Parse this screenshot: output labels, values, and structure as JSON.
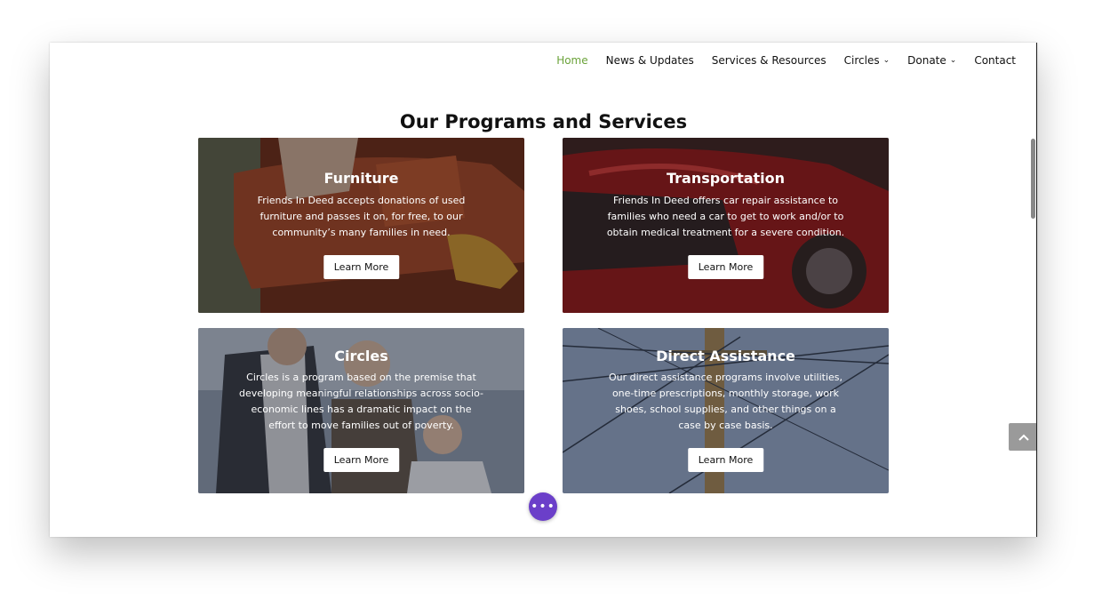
{
  "nav": {
    "items": [
      {
        "label": "Home",
        "active": true
      },
      {
        "label": "News & Updates"
      },
      {
        "label": "Services & Resources"
      },
      {
        "label": "Circles",
        "dropdown": true
      },
      {
        "label": "Donate",
        "dropdown": true
      },
      {
        "label": "Contact"
      }
    ]
  },
  "section": {
    "title": "Our Programs and Services"
  },
  "cards": [
    {
      "title": "Furniture",
      "text": "Friends In Deed accepts donations of used furniture and passes it on, for free, to our community’s many families in need.",
      "button": "Learn More"
    },
    {
      "title": "Transportation",
      "text": "Friends In Deed offers car repair assistance to families who need a car to get to work and/or to obtain medical treatment for a severe condition.",
      "button": "Learn More"
    },
    {
      "title": "Circles",
      "text": "Circles is a program  based on the premise that developing meaningful relationships across socio-economic lines has a dramatic impact on the effort to move families out of poverty.",
      "button": "Learn More"
    },
    {
      "title": "Direct Assistance",
      "text": "Our direct assistance programs involve utilities, one-time prescriptions, monthly storage, work shoes, school supplies, and other things on a case by case basis.",
      "button": "Learn More"
    }
  ],
  "icons": {
    "dropdown": "chevron-down-icon",
    "back_to_top": "chevron-up-icon",
    "fab": "more-dots-icon"
  },
  "colors": {
    "active_nav": "#6ba33a",
    "fab": "#6b3fc9"
  }
}
